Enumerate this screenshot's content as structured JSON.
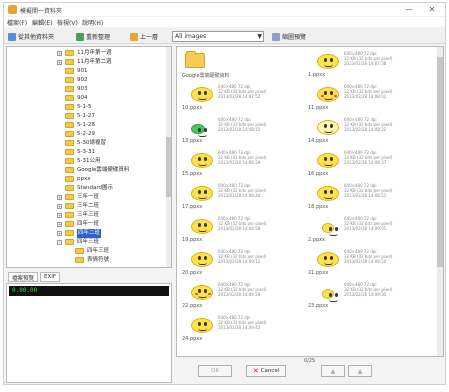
{
  "window": {
    "title": "模擬開一資料夾",
    "minimize": "—",
    "close": "✕"
  },
  "menu": [
    {
      "label": "檔案(F)"
    },
    {
      "label": "編輯(E)"
    },
    {
      "label": "檢視(V)"
    },
    {
      "label": "說明(H)"
    }
  ],
  "toolbar": {
    "source": "從其他資料夾",
    "refresh": "重新整理",
    "up": "上一層",
    "filter": "All images",
    "view": "縮圖預覽"
  },
  "tree": [
    {
      "label": "11月年第一週",
      "depth": 1,
      "plus": true
    },
    {
      "label": "11月年第二週",
      "depth": 1,
      "plus": true
    },
    {
      "label": "901",
      "depth": 1
    },
    {
      "label": "902",
      "depth": 1
    },
    {
      "label": "903",
      "depth": 1
    },
    {
      "label": "904",
      "depth": 1
    },
    {
      "label": "5-1-5",
      "depth": 1
    },
    {
      "label": "5-1-27",
      "depth": 1
    },
    {
      "label": "5-1-28",
      "depth": 1
    },
    {
      "label": "5-2-29",
      "depth": 1
    },
    {
      "label": "5-30總複習",
      "depth": 1
    },
    {
      "label": "5-3-31",
      "depth": 1
    },
    {
      "label": "5-31公用",
      "depth": 1
    },
    {
      "label": "Google雲端硬碟資料",
      "depth": 1
    },
    {
      "label": "ppxx",
      "depth": 1
    },
    {
      "label": "Standard圖示",
      "depth": 1
    },
    {
      "label": "三年一班",
      "depth": 1,
      "plus": true
    },
    {
      "label": "三年二班",
      "depth": 1,
      "plus": true
    },
    {
      "label": "三年三班",
      "depth": 1,
      "plus": true
    },
    {
      "label": "四年一班",
      "depth": 1,
      "plus": true
    },
    {
      "label": "四年二班",
      "depth": 1,
      "plus": true,
      "selected": true
    },
    {
      "label": "四年三班",
      "depth": 1,
      "plus": true
    },
    {
      "label": "四年三班",
      "depth": 2
    },
    {
      "label": "表情符號",
      "depth": 2
    }
  ],
  "info": {
    "tab1": "檔案預覽",
    "tab2": "EXIF",
    "value": "0.00.00"
  },
  "thumbs": [
    {
      "kind": "folder",
      "name": "Google雲端硬碟資料",
      "meta": [
        "",
        "",
        ""
      ]
    },
    {
      "kind": "face",
      "name": "1.ppxx",
      "meta": [
        "640×480  72 dpi",
        "32 KB (32 bits per pixel)",
        "2013/02/28  14:07:38"
      ],
      "variant": "plain"
    },
    {
      "kind": "face",
      "name": "10.ppxx",
      "meta": [
        "640×480  72 dpi",
        "32 KB (32 bits per pixel)",
        "2013/02/28  14:07:52"
      ],
      "variant": "plain"
    },
    {
      "kind": "face",
      "name": "11.ppxx",
      "meta": [
        "640×480  72 dpi",
        "32 KB (32 bits per pixel)",
        "2013/02/28  14:08:02"
      ],
      "variant": "blush"
    },
    {
      "kind": "face",
      "name": "13.ppxx",
      "meta": [
        "640×480  72 dpi",
        "32 KB (32 bits per pixel)",
        "2013/02/28  14:08:15"
      ],
      "variant": "green"
    },
    {
      "kind": "face",
      "name": "14.ppxx",
      "meta": [
        "640×480  72 dpi",
        "32 KB (32 bits per pixel)",
        "2013/02/28  14:08:22"
      ],
      "variant": "pale"
    },
    {
      "kind": "face",
      "name": "15.ppxx",
      "meta": [
        "640×480  72 dpi",
        "32 KB (32 bits per pixel)",
        "2013/02/28  14:08:29"
      ],
      "variant": "plain"
    },
    {
      "kind": "face",
      "name": "16.ppxx",
      "meta": [
        "640×480  72 dpi",
        "32 KB (32 bits per pixel)",
        "2013/02/28  14:08:37"
      ],
      "variant": "plain"
    },
    {
      "kind": "face",
      "name": "17.ppxx",
      "meta": [
        "640×480  72 dpi",
        "32 KB (32 bits per pixel)",
        "2013/02/28  14:08:44"
      ],
      "variant": "plain"
    },
    {
      "kind": "face",
      "name": "18.ppxx",
      "meta": [
        "640×480  72 dpi",
        "32 KB (32 bits per pixel)",
        "2013/02/28  14:08:51"
      ],
      "variant": "plain"
    },
    {
      "kind": "face",
      "name": "19.ppxx",
      "meta": [
        "640×480  72 dpi",
        "32 KB (32 bits per pixel)",
        "2013/02/28  14:08:58"
      ],
      "variant": "plain"
    },
    {
      "kind": "face",
      "name": "2.ppxx",
      "meta": [
        "640×480  72 dpi",
        "32 KB (32 bits per pixel)",
        "2013/02/28  14:09:05"
      ],
      "variant": "small"
    },
    {
      "kind": "face",
      "name": "20.ppxx",
      "meta": [
        "640×480  72 dpi",
        "32 KB (32 bits per pixel)",
        "2013/02/28  14:09:12"
      ],
      "variant": "plain"
    },
    {
      "kind": "face",
      "name": "21.ppxx",
      "meta": [
        "640×480  72 dpi",
        "32 KB (32 bits per pixel)",
        "2013/02/28  14:09:20"
      ],
      "variant": "plain"
    },
    {
      "kind": "face",
      "name": "22.ppxx",
      "meta": [
        "640×480  72 dpi",
        "32 KB (32 bits per pixel)",
        "2013/02/28  14:09:28"
      ],
      "variant": "blush"
    },
    {
      "kind": "face",
      "name": "23.ppxx",
      "meta": [
        "640×480  72 dpi",
        "32 KB (32 bits per pixel)",
        "2013/02/28  14:09:35"
      ],
      "variant": "small"
    },
    {
      "kind": "face",
      "name": "24.ppxx",
      "meta": [
        "640×480  72 dpi",
        "32 KB (32 bits per pixel)",
        "2013/02/28  14:09:42"
      ],
      "variant": "plain"
    }
  ],
  "bottom": {
    "counter": "0/25",
    "ok": "OK",
    "cancel": "Cancel"
  },
  "colors": {
    "selection": "#2f62c8",
    "face": "#ffe24a",
    "info_text": "#3cd85a"
  }
}
